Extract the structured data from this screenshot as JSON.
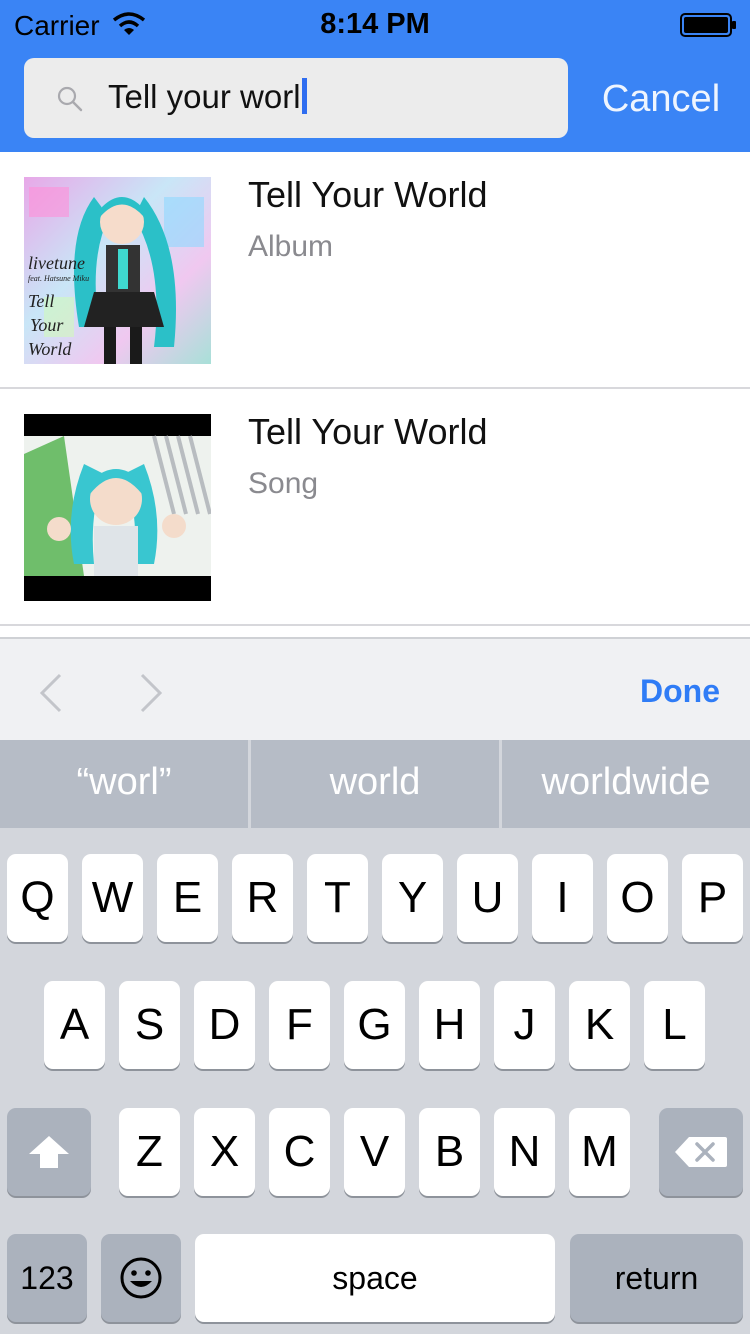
{
  "status_bar": {
    "carrier": "Carrier",
    "time": "8:14 PM"
  },
  "search": {
    "query": "Tell your worl",
    "cancel_label": "Cancel"
  },
  "results": [
    {
      "title": "Tell Your World",
      "subtitle": "Album",
      "art_text": [
        "livetune",
        "feat. Hatsune Miku",
        "Tell",
        "Your",
        "World"
      ]
    },
    {
      "title": "Tell Your World",
      "subtitle": "Song"
    }
  ],
  "toolbar": {
    "done_label": "Done"
  },
  "keyboard": {
    "suggestions": [
      "“worl”",
      "world",
      "worldwide"
    ],
    "row1": [
      "Q",
      "W",
      "E",
      "R",
      "T",
      "Y",
      "U",
      "I",
      "O",
      "P"
    ],
    "row2": [
      "A",
      "S",
      "D",
      "F",
      "G",
      "H",
      "J",
      "K",
      "L"
    ],
    "row3": [
      "Z",
      "X",
      "C",
      "V",
      "B",
      "N",
      "M"
    ],
    "numbers_label": "123",
    "space_label": "space",
    "return_label": "return"
  },
  "colors": {
    "header": "#3a84f5",
    "accent": "#2f7cf6"
  }
}
